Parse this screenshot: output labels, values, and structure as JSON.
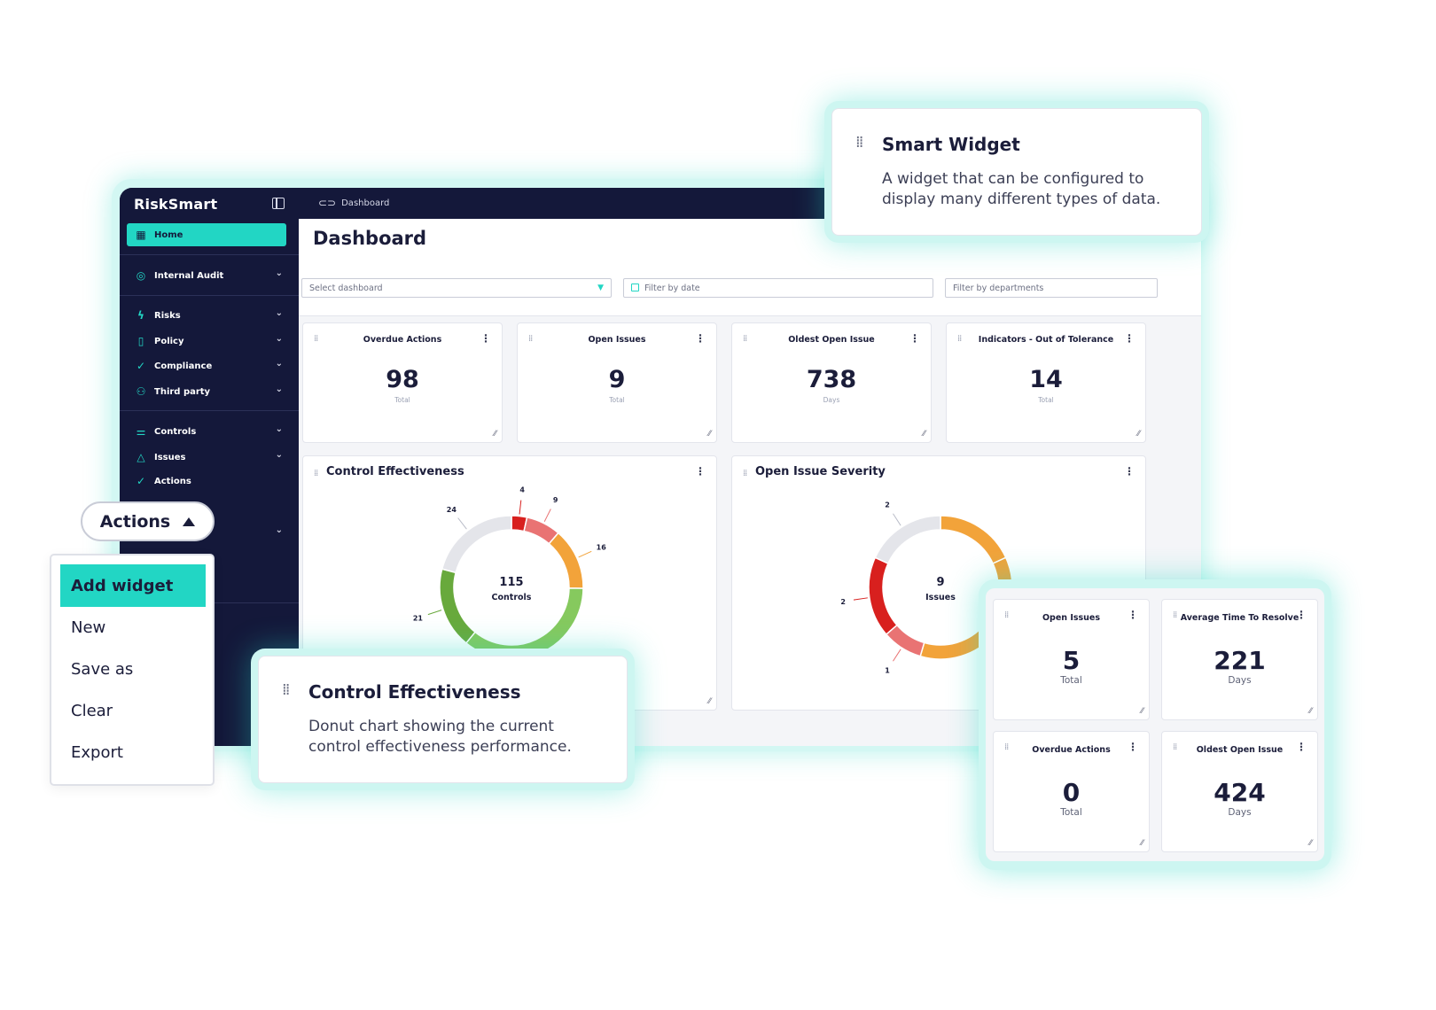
{
  "app": {
    "brand": "RiskSmart",
    "breadcrumb": "Dashboard",
    "page_title": "Dashboard"
  },
  "sidebar": {
    "items": [
      {
        "label": "Home",
        "icon": "grid-icon",
        "active": true
      },
      {
        "label": "Internal Audit",
        "icon": "target-icon"
      },
      {
        "label": "Risks",
        "icon": "bolt-icon"
      },
      {
        "label": "Policy",
        "icon": "document-icon"
      },
      {
        "label": "Compliance",
        "icon": "check-circle-icon"
      },
      {
        "label": "Third party",
        "icon": "users-icon"
      },
      {
        "label": "Controls",
        "icon": "sliders-icon"
      },
      {
        "label": "Issues",
        "icon": "warning-icon"
      },
      {
        "label": "Actions",
        "icon": "check-circle-icon"
      }
    ]
  },
  "filters": {
    "dashboard_placeholder": "Select dashboard",
    "date_placeholder": "Filter by date",
    "departments_placeholder": "Filter by departments"
  },
  "kpis": [
    {
      "title": "Overdue Actions",
      "value": "98",
      "unit": "Total"
    },
    {
      "title": "Open Issues",
      "value": "9",
      "unit": "Total"
    },
    {
      "title": "Oldest Open Issue",
      "value": "738",
      "unit": "Days"
    },
    {
      "title": "Indicators - Out of Tolerance",
      "value": "14",
      "unit": "Total"
    }
  ],
  "charts": {
    "control_title": "Control Effectiveness",
    "severity_title": "Open Issue Severity"
  },
  "chart_data": [
    {
      "type": "pie",
      "title": "Control Effectiveness",
      "center_value": "115",
      "center_label": "Controls",
      "slices": [
        {
          "value": 4,
          "label": "4",
          "color": "#d8201e"
        },
        {
          "value": 9,
          "label": "9",
          "color": "#e97373"
        },
        {
          "value": 16,
          "label": "16",
          "color": "#f2a33a"
        },
        {
          "value": 41,
          "label": "41",
          "color": "#86c95e"
        },
        {
          "value": 21,
          "label": "21",
          "color": "#68a93c"
        },
        {
          "value": 24,
          "label": "24",
          "color": "#e4e5ea"
        }
      ]
    },
    {
      "type": "pie",
      "title": "Open Issue Severity",
      "center_value": "9",
      "center_label": "Issues",
      "slices": [
        {
          "value": 2,
          "label": "",
          "color": "#f2a33a"
        },
        {
          "value": 4,
          "label": "4",
          "color": "#f2a33a"
        },
        {
          "value": 1,
          "label": "1",
          "color": "#e97373"
        },
        {
          "value": 2,
          "label": "2",
          "color": "#d8201e"
        },
        {
          "value": 2,
          "label": "2",
          "color": "#e4e5ea"
        }
      ]
    }
  ],
  "actions": {
    "button_label": "Actions",
    "menu": [
      "Add widget",
      "New",
      "Save as",
      "Clear",
      "Export"
    ]
  },
  "callouts": {
    "smart_title": "Smart Widget",
    "smart_desc_1": "A widget that can be configured to",
    "smart_desc_2": "display many different types of data.",
    "control_title": "Control Effectiveness",
    "control_desc_1": "Donut chart showing the current",
    "control_desc_2": "control effectiveness performance."
  },
  "mini_kpis": [
    {
      "title": "Open Issues",
      "value": "5",
      "unit": "Total"
    },
    {
      "title": "Average Time To Resolve",
      "value": "221",
      "unit": "Days"
    },
    {
      "title": "Overdue Actions",
      "value": "0",
      "unit": "Total"
    },
    {
      "title": "Oldest Open Issue",
      "value": "424",
      "unit": "Days"
    }
  ],
  "colors": {
    "accent": "#22d6c4",
    "navy": "#14183a"
  }
}
